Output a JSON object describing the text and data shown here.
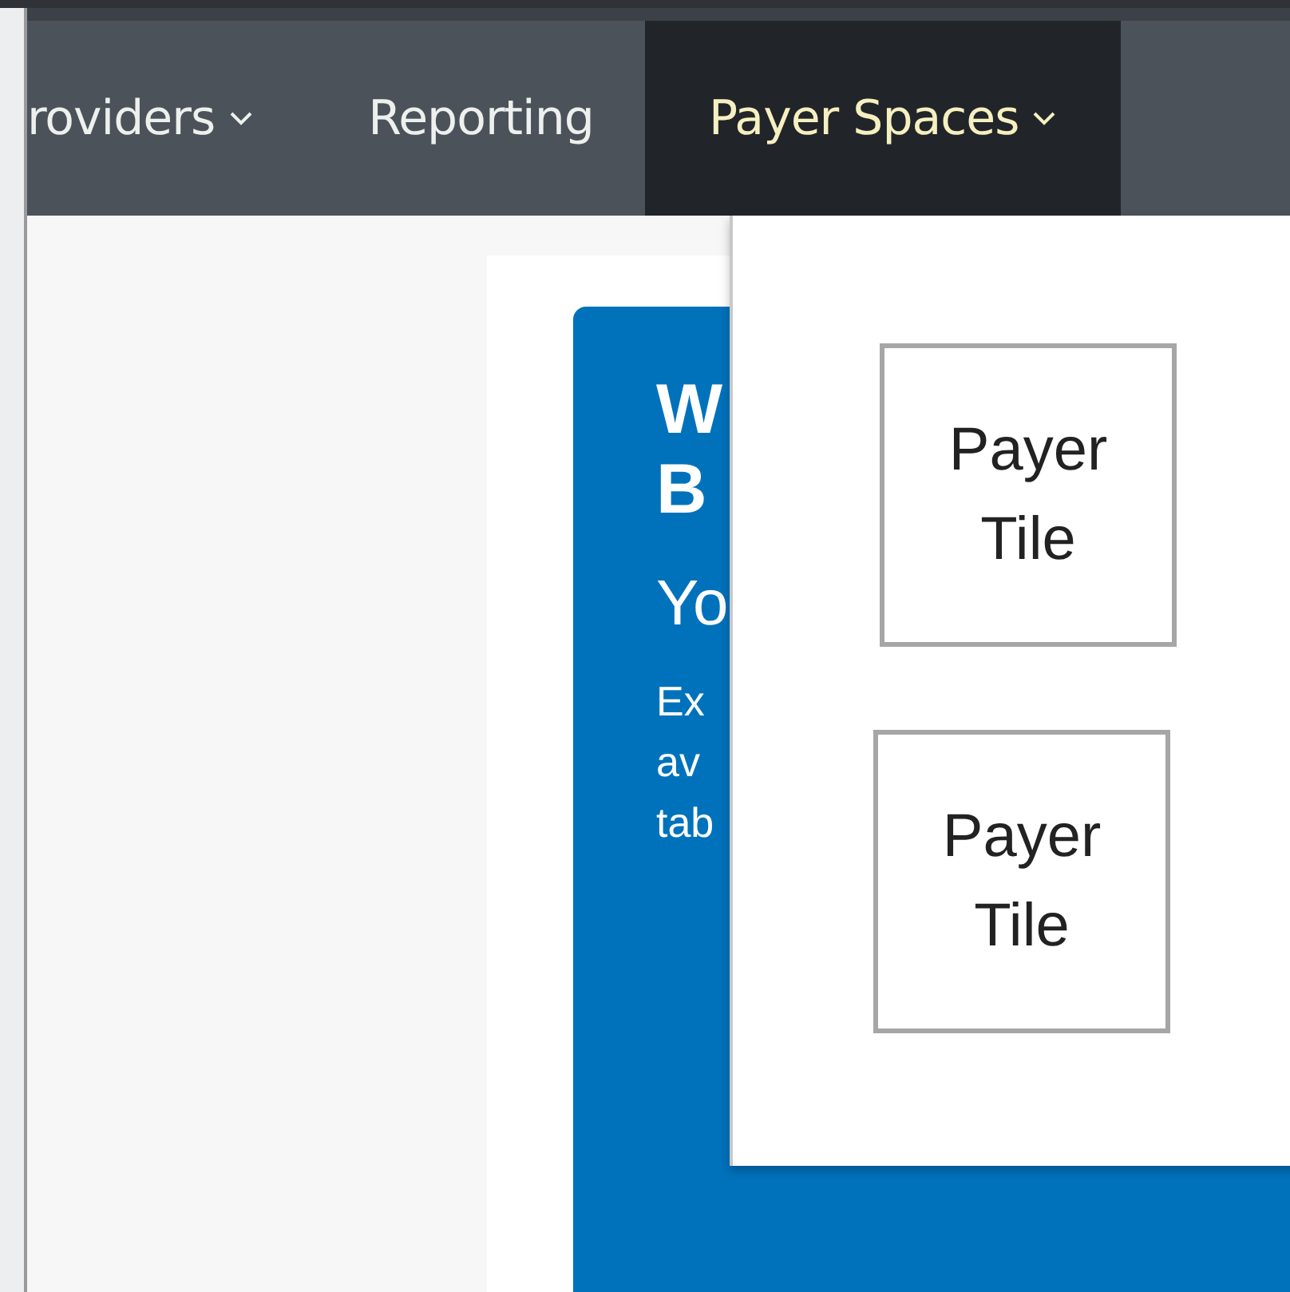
{
  "nav": [
    {
      "label": "roviders",
      "selected": false,
      "caret": true
    },
    {
      "label": "Reporting",
      "selected": false,
      "caret": false
    },
    {
      "label": "Payer Spaces",
      "selected": true,
      "caret": true
    }
  ],
  "welcome_card": {
    "heading_lines": [
      "W",
      "B"
    ],
    "subtitle": "Yo",
    "body_lines": [
      "Ex",
      "av",
      "tab"
    ]
  },
  "dropdown": {
    "open": true,
    "tiles": [
      {
        "label": "Payer Tile"
      },
      {
        "label": "Payer Tile"
      }
    ]
  }
}
